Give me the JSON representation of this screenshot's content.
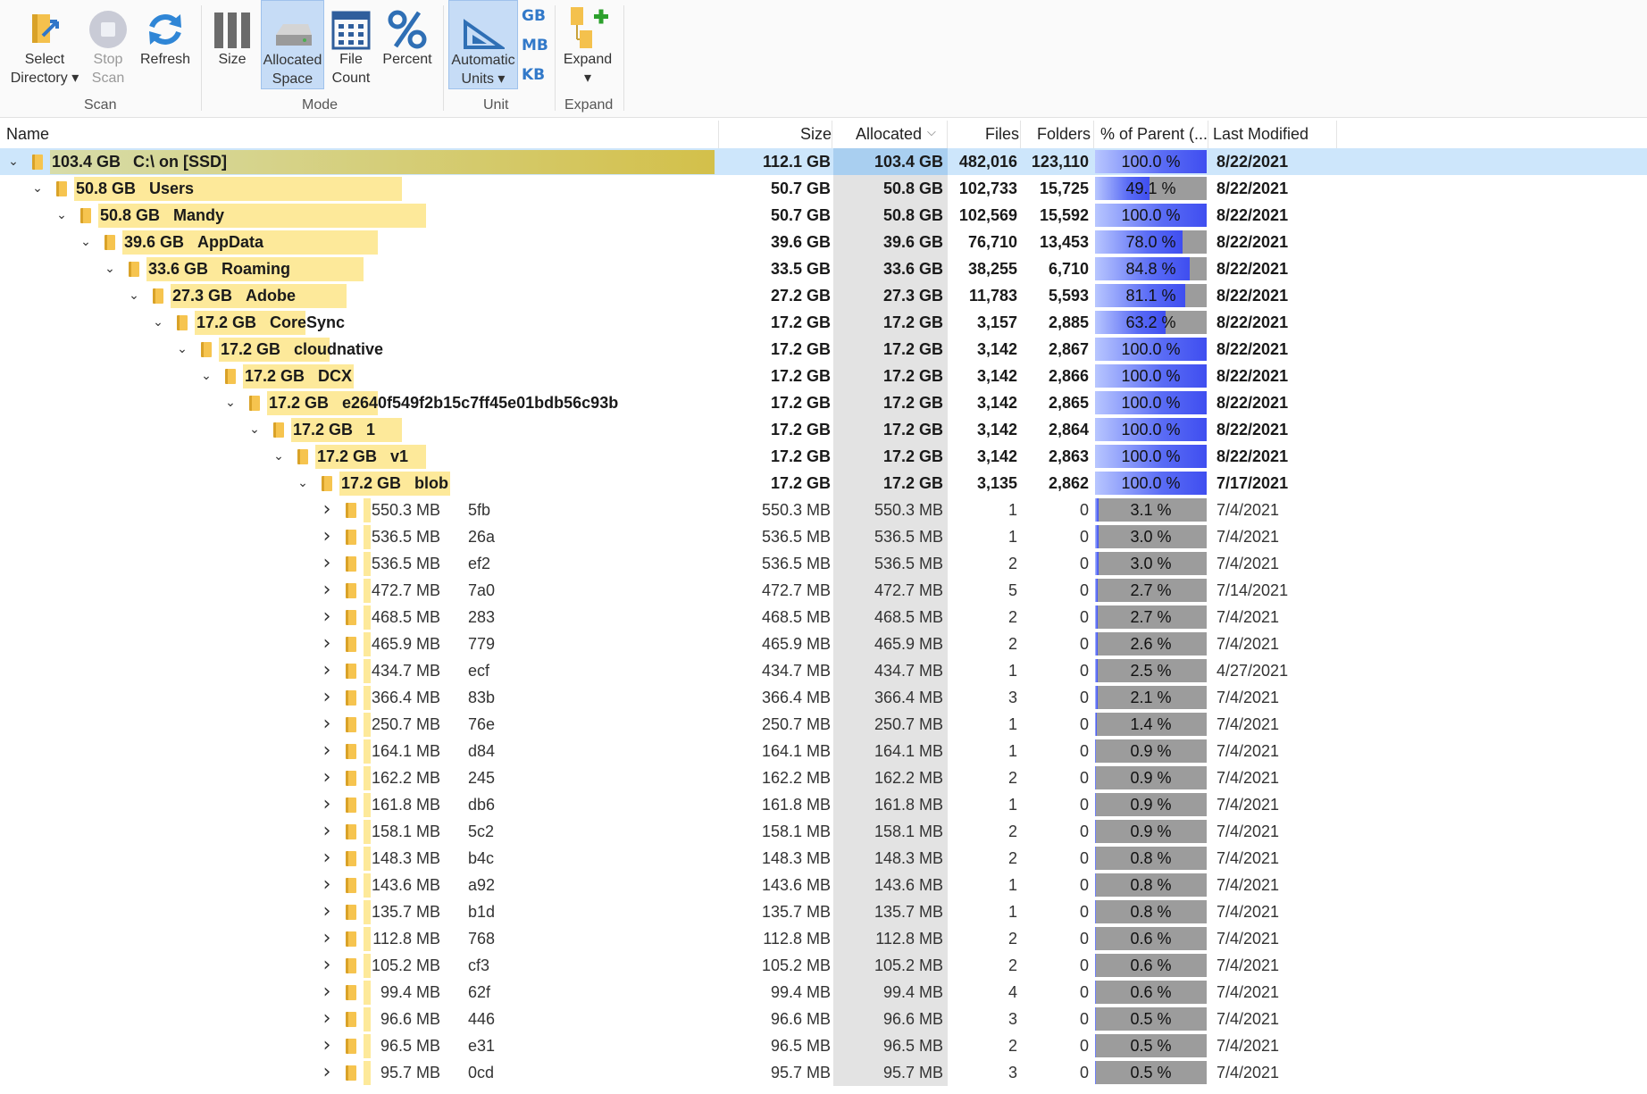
{
  "ribbon": {
    "scan_group": "Scan",
    "mode_group": "Mode",
    "unit_group": "Unit",
    "expand_group": "Expand",
    "select_directory": "Select\nDirectory ▾",
    "stop_scan": "Stop\nScan",
    "refresh": "Refresh",
    "size": "Size",
    "allocated_space": "Allocated\nSpace",
    "file_count": "File\nCount",
    "percent": "Percent",
    "automatic_units": "Automatic\nUnits ▾",
    "unit_gb": "GB",
    "unit_mb": "MB",
    "unit_kb": "KB",
    "expand": "Expand\n▾"
  },
  "columns": {
    "name": "Name",
    "size": "Size",
    "allocated": "Allocated",
    "files": "Files",
    "folders": "Folders",
    "pct_parent": "% of Parent (...",
    "last_modified": "Last Modified"
  },
  "rows": [
    {
      "label": "103.4 GB",
      "name": "C:\\  on  [SSD]",
      "size": "112.1 GB",
      "allocated": "103.4 GB",
      "files": "482,016",
      "folders": "123,110",
      "pct": "100.0 %",
      "pct_value": 100.0,
      "modified": "8/22/2021",
      "level": 0,
      "expanded": true,
      "bold": true,
      "selected": true,
      "bar": 1.0
    },
    {
      "label": "50.8 GB",
      "name": "Users",
      "size": "50.7 GB",
      "allocated": "50.8 GB",
      "files": "102,733",
      "folders": "15,725",
      "pct": "49.1 %",
      "pct_value": 49.1,
      "modified": "8/22/2021",
      "level": 1,
      "expanded": true,
      "bold": true,
      "bar": 0.491
    },
    {
      "label": "50.8 GB",
      "name": "Mandy",
      "size": "50.7 GB",
      "allocated": "50.8 GB",
      "files": "102,569",
      "folders": "15,592",
      "pct": "100.0 %",
      "pct_value": 100.0,
      "modified": "8/22/2021",
      "level": 2,
      "expanded": true,
      "bold": true,
      "bar": 0.491
    },
    {
      "label": "39.6 GB",
      "name": "AppData",
      "size": "39.6 GB",
      "allocated": "39.6 GB",
      "files": "76,710",
      "folders": "13,453",
      "pct": "78.0 %",
      "pct_value": 78.0,
      "modified": "8/22/2021",
      "level": 3,
      "expanded": true,
      "bold": true,
      "bar": 0.383
    },
    {
      "label": "33.6 GB",
      "name": "Roaming",
      "size": "33.5 GB",
      "allocated": "33.6 GB",
      "files": "38,255",
      "folders": "6,710",
      "pct": "84.8 %",
      "pct_value": 84.8,
      "modified": "8/22/2021",
      "level": 4,
      "expanded": true,
      "bold": true,
      "bar": 0.325
    },
    {
      "label": "27.3 GB",
      "name": "Adobe",
      "size": "27.2 GB",
      "allocated": "27.3 GB",
      "files": "11,783",
      "folders": "5,593",
      "pct": "81.1 %",
      "pct_value": 81.1,
      "modified": "8/22/2021",
      "level": 5,
      "expanded": true,
      "bold": true,
      "bar": 0.264
    },
    {
      "label": "17.2 GB",
      "name": "CoreSync",
      "size": "17.2 GB",
      "allocated": "17.2 GB",
      "files": "3,157",
      "folders": "2,885",
      "pct": "63.2 %",
      "pct_value": 63.2,
      "modified": "8/22/2021",
      "level": 6,
      "expanded": true,
      "bold": true,
      "bar": 0.166
    },
    {
      "label": "17.2 GB",
      "name": "cloudnative",
      "size": "17.2 GB",
      "allocated": "17.2 GB",
      "files": "3,142",
      "folders": "2,867",
      "pct": "100.0 %",
      "pct_value": 100.0,
      "modified": "8/22/2021",
      "level": 7,
      "expanded": true,
      "bold": true,
      "bar": 0.166
    },
    {
      "label": "17.2 GB",
      "name": "DCX",
      "size": "17.2 GB",
      "allocated": "17.2 GB",
      "files": "3,142",
      "folders": "2,866",
      "pct": "100.0 %",
      "pct_value": 100.0,
      "modified": "8/22/2021",
      "level": 8,
      "expanded": true,
      "bold": true,
      "bar": 0.166
    },
    {
      "label": "17.2 GB",
      "name": "e2640f549f2b15c7ff45e01bdb56c93b",
      "size": "17.2 GB",
      "allocated": "17.2 GB",
      "files": "3,142",
      "folders": "2,865",
      "pct": "100.0 %",
      "pct_value": 100.0,
      "modified": "8/22/2021",
      "level": 9,
      "expanded": true,
      "bold": true,
      "bar": 0.166
    },
    {
      "label": "17.2 GB",
      "name": "1",
      "size": "17.2 GB",
      "allocated": "17.2 GB",
      "files": "3,142",
      "folders": "2,864",
      "pct": "100.0 %",
      "pct_value": 100.0,
      "modified": "8/22/2021",
      "level": 10,
      "expanded": true,
      "bold": true,
      "bar": 0.166
    },
    {
      "label": "17.2 GB",
      "name": "v1",
      "size": "17.2 GB",
      "allocated": "17.2 GB",
      "files": "3,142",
      "folders": "2,863",
      "pct": "100.0 %",
      "pct_value": 100.0,
      "modified": "8/22/2021",
      "level": 11,
      "expanded": true,
      "bold": true,
      "bar": 0.166
    },
    {
      "label": "17.2 GB",
      "name": "blob",
      "size": "17.2 GB",
      "allocated": "17.2 GB",
      "files": "3,135",
      "folders": "2,862",
      "pct": "100.0 %",
      "pct_value": 100.0,
      "modified": "7/17/2021",
      "level": 12,
      "expanded": true,
      "bold": true,
      "bar": 0.166
    },
    {
      "label": "550.3 MB",
      "name": "5fb",
      "size": "550.3 MB",
      "allocated": "550.3 MB",
      "files": "1",
      "folders": "0",
      "pct": "3.1 %",
      "pct_value": 3.1,
      "modified": "7/4/2021",
      "level": 13,
      "expanded": false,
      "bold": false,
      "bar": 0.005
    },
    {
      "label": "536.5 MB",
      "name": "26a",
      "size": "536.5 MB",
      "allocated": "536.5 MB",
      "files": "1",
      "folders": "0",
      "pct": "3.0 %",
      "pct_value": 3.0,
      "modified": "7/4/2021",
      "level": 13,
      "expanded": false,
      "bold": false,
      "bar": 0.005
    },
    {
      "label": "536.5 MB",
      "name": "ef2",
      "size": "536.5 MB",
      "allocated": "536.5 MB",
      "files": "2",
      "folders": "0",
      "pct": "3.0 %",
      "pct_value": 3.0,
      "modified": "7/4/2021",
      "level": 13,
      "expanded": false,
      "bold": false,
      "bar": 0.005
    },
    {
      "label": "472.7 MB",
      "name": "7a0",
      "size": "472.7 MB",
      "allocated": "472.7 MB",
      "files": "5",
      "folders": "0",
      "pct": "2.7 %",
      "pct_value": 2.7,
      "modified": "7/14/2021",
      "level": 13,
      "expanded": false,
      "bold": false,
      "bar": 0.004
    },
    {
      "label": "468.5 MB",
      "name": "283",
      "size": "468.5 MB",
      "allocated": "468.5 MB",
      "files": "2",
      "folders": "0",
      "pct": "2.7 %",
      "pct_value": 2.7,
      "modified": "7/4/2021",
      "level": 13,
      "expanded": false,
      "bold": false,
      "bar": 0.004
    },
    {
      "label": "465.9 MB",
      "name": "779",
      "size": "465.9 MB",
      "allocated": "465.9 MB",
      "files": "2",
      "folders": "0",
      "pct": "2.6 %",
      "pct_value": 2.6,
      "modified": "7/4/2021",
      "level": 13,
      "expanded": false,
      "bold": false,
      "bar": 0.004
    },
    {
      "label": "434.7 MB",
      "name": "ecf",
      "size": "434.7 MB",
      "allocated": "434.7 MB",
      "files": "1",
      "folders": "0",
      "pct": "2.5 %",
      "pct_value": 2.5,
      "modified": "4/27/2021",
      "level": 13,
      "expanded": false,
      "bold": false,
      "bar": 0.004
    },
    {
      "label": "366.4 MB",
      "name": "83b",
      "size": "366.4 MB",
      "allocated": "366.4 MB",
      "files": "3",
      "folders": "0",
      "pct": "2.1 %",
      "pct_value": 2.1,
      "modified": "7/4/2021",
      "level": 13,
      "expanded": false,
      "bold": false,
      "bar": 0.003
    },
    {
      "label": "250.7 MB",
      "name": "76e",
      "size": "250.7 MB",
      "allocated": "250.7 MB",
      "files": "1",
      "folders": "0",
      "pct": "1.4 %",
      "pct_value": 1.4,
      "modified": "7/4/2021",
      "level": 13,
      "expanded": false,
      "bold": false,
      "bar": 0.002
    },
    {
      "label": "164.1 MB",
      "name": "d84",
      "size": "164.1 MB",
      "allocated": "164.1 MB",
      "files": "1",
      "folders": "0",
      "pct": "0.9 %",
      "pct_value": 0.9,
      "modified": "7/4/2021",
      "level": 13,
      "expanded": false,
      "bold": false,
      "bar": 0.002
    },
    {
      "label": "162.2 MB",
      "name": "245",
      "size": "162.2 MB",
      "allocated": "162.2 MB",
      "files": "2",
      "folders": "0",
      "pct": "0.9 %",
      "pct_value": 0.9,
      "modified": "7/4/2021",
      "level": 13,
      "expanded": false,
      "bold": false,
      "bar": 0.002
    },
    {
      "label": "161.8 MB",
      "name": "db6",
      "size": "161.8 MB",
      "allocated": "161.8 MB",
      "files": "1",
      "folders": "0",
      "pct": "0.9 %",
      "pct_value": 0.9,
      "modified": "7/4/2021",
      "level": 13,
      "expanded": false,
      "bold": false,
      "bar": 0.002
    },
    {
      "label": "158.1 MB",
      "name": "5c2",
      "size": "158.1 MB",
      "allocated": "158.1 MB",
      "files": "2",
      "folders": "0",
      "pct": "0.9 %",
      "pct_value": 0.9,
      "modified": "7/4/2021",
      "level": 13,
      "expanded": false,
      "bold": false,
      "bar": 0.002
    },
    {
      "label": "148.3 MB",
      "name": "b4c",
      "size": "148.3 MB",
      "allocated": "148.3 MB",
      "files": "2",
      "folders": "0",
      "pct": "0.8 %",
      "pct_value": 0.8,
      "modified": "7/4/2021",
      "level": 13,
      "expanded": false,
      "bold": false,
      "bar": 0.001
    },
    {
      "label": "143.6 MB",
      "name": "a92",
      "size": "143.6 MB",
      "allocated": "143.6 MB",
      "files": "1",
      "folders": "0",
      "pct": "0.8 %",
      "pct_value": 0.8,
      "modified": "7/4/2021",
      "level": 13,
      "expanded": false,
      "bold": false,
      "bar": 0.001
    },
    {
      "label": "135.7 MB",
      "name": "b1d",
      "size": "135.7 MB",
      "allocated": "135.7 MB",
      "files": "1",
      "folders": "0",
      "pct": "0.8 %",
      "pct_value": 0.8,
      "modified": "7/4/2021",
      "level": 13,
      "expanded": false,
      "bold": false,
      "bar": 0.001
    },
    {
      "label": "112.8 MB",
      "name": "768",
      "size": "112.8 MB",
      "allocated": "112.8 MB",
      "files": "2",
      "folders": "0",
      "pct": "0.6 %",
      "pct_value": 0.6,
      "modified": "7/4/2021",
      "level": 13,
      "expanded": false,
      "bold": false,
      "bar": 0.001
    },
    {
      "label": "105.2 MB",
      "name": "cf3",
      "size": "105.2 MB",
      "allocated": "105.2 MB",
      "files": "2",
      "folders": "0",
      "pct": "0.6 %",
      "pct_value": 0.6,
      "modified": "7/4/2021",
      "level": 13,
      "expanded": false,
      "bold": false,
      "bar": 0.001
    },
    {
      "label": "99.4 MB",
      "name": "62f",
      "size": "99.4 MB",
      "allocated": "99.4 MB",
      "files": "4",
      "folders": "0",
      "pct": "0.6 %",
      "pct_value": 0.6,
      "modified": "7/4/2021",
      "level": 13,
      "expanded": false,
      "bold": false,
      "bar": 0.001
    },
    {
      "label": "96.6 MB",
      "name": "446",
      "size": "96.6 MB",
      "allocated": "96.6 MB",
      "files": "3",
      "folders": "0",
      "pct": "0.5 %",
      "pct_value": 0.5,
      "modified": "7/4/2021",
      "level": 13,
      "expanded": false,
      "bold": false,
      "bar": 0.001
    },
    {
      "label": "96.5 MB",
      "name": "e31",
      "size": "96.5 MB",
      "allocated": "96.5 MB",
      "files": "2",
      "folders": "0",
      "pct": "0.5 %",
      "pct_value": 0.5,
      "modified": "7/4/2021",
      "level": 13,
      "expanded": false,
      "bold": false,
      "bar": 0.001
    },
    {
      "label": "95.7 MB",
      "name": "0cd",
      "size": "95.7 MB",
      "allocated": "95.7 MB",
      "files": "3",
      "folders": "0",
      "pct": "0.5 %",
      "pct_value": 0.5,
      "modified": "7/4/2021",
      "level": 13,
      "expanded": false,
      "bold": false,
      "bar": 0.001
    }
  ],
  "colors": {
    "selection": "#cde6fb",
    "bar": "#fde99a",
    "pct_fill": "#3f4ef0",
    "pct_bg": "#9c9c9c"
  }
}
